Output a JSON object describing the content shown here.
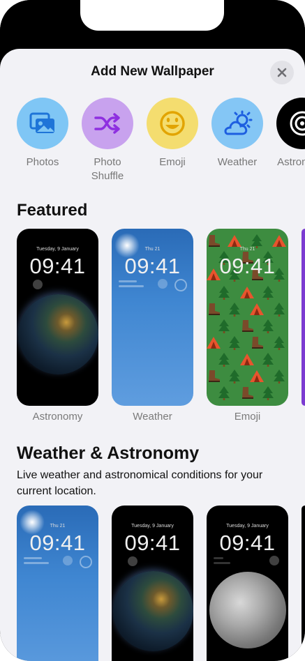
{
  "sheet": {
    "title": "Add New Wallpaper"
  },
  "categories": [
    {
      "label": "Photos",
      "icon": "photos-icon",
      "bg": "#7fc6f5"
    },
    {
      "label": "Photo\nShuffle",
      "icon": "shuffle-icon",
      "bg": "#c8a2ee"
    },
    {
      "label": "Emoji",
      "icon": "emoji-icon",
      "bg": "#f4dd6f"
    },
    {
      "label": "Weather",
      "icon": "weather-icon",
      "bg": "#84c6f5"
    },
    {
      "label": "Astronomy",
      "icon": "astronomy-icon",
      "bg": "#000000"
    }
  ],
  "featured": {
    "title": "Featured",
    "cards": [
      {
        "label": "Astronomy",
        "date": "Tuesday, 9 January",
        "time": "09:41"
      },
      {
        "label": "Weather",
        "date": "Thu 21",
        "time": "09:41"
      },
      {
        "label": "Emoji",
        "date": "Thu 21",
        "time": "09:41"
      }
    ]
  },
  "weather_astronomy": {
    "title": "Weather & Astronomy",
    "subtitle": "Live weather and astronomical conditions for your current location.",
    "cards": [
      {
        "date": "Thu 21",
        "time": "09:41"
      },
      {
        "date": "Tuesday, 9 January",
        "time": "09:41"
      },
      {
        "date": "Tuesday, 9 January",
        "time": "09:41"
      }
    ]
  }
}
